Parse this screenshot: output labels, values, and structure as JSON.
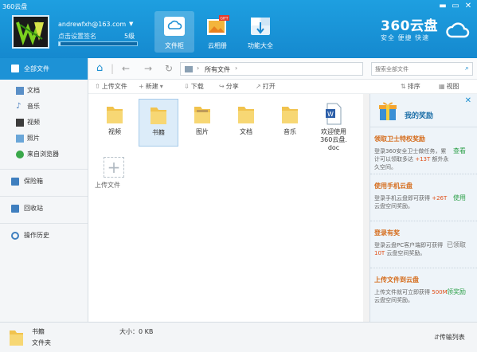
{
  "app": {
    "title": "360云盘"
  },
  "window_controls": [
    "▬",
    "▭",
    "✕"
  ],
  "user": {
    "email": "andrewfxh@163.com",
    "signature_placeholder": "点击设置签名",
    "level": "5级",
    "quota_fraction": 0.02
  },
  "header_tabs": [
    {
      "label": "文件柜",
      "icon": "cloud-cabinet-icon",
      "active": true
    },
    {
      "label": "云相册",
      "icon": "photo-album-icon",
      "active": false,
      "badge": "GIFT"
    },
    {
      "label": "功能大全",
      "icon": "toolbox-icon",
      "active": false
    }
  ],
  "brand": {
    "name": "360云盘",
    "slogan": "安全 便捷 快速"
  },
  "sidebar": {
    "all_files": "全部文件",
    "items": [
      {
        "label": "文档",
        "icon": "document-icon"
      },
      {
        "label": "音乐",
        "icon": "music-icon"
      },
      {
        "label": "视频",
        "icon": "video-icon"
      },
      {
        "label": "照片",
        "icon": "photo-icon"
      },
      {
        "label": "来自浏览器",
        "icon": "browser-icon"
      }
    ],
    "safe_box": "保险箱",
    "recycle_bin": "回收站",
    "history": "操作历史"
  },
  "nav": {
    "breadcrumb": "所有文件",
    "search_placeholder": "搜索全部文件"
  },
  "toolbar": {
    "upload": "上传文件",
    "new": "新建",
    "download": "下载",
    "share": "分享",
    "open": "打开",
    "sort": "排序",
    "view": "视图"
  },
  "files": [
    {
      "name": "视频",
      "type": "folder"
    },
    {
      "name": "书籍",
      "type": "folder",
      "selected": true
    },
    {
      "name": "图片",
      "type": "folder"
    },
    {
      "name": "文档",
      "type": "folder"
    },
    {
      "name": "音乐",
      "type": "folder"
    },
    {
      "name": "欢迎使用\n360云盘.\ndoc",
      "type": "doc"
    }
  ],
  "upload_label": "上传文件",
  "rewards": {
    "title": "我的奖励",
    "items": [
      {
        "title": "领取卫士特权奖励",
        "desc_pre": "登录360安全卫士做任务，累计可以领取多达 ",
        "highlight": "+13T",
        "desc_post": " 额外永久空间。",
        "action": "查看",
        "done": false
      },
      {
        "title": "使用手机云盘",
        "desc_pre": "登录手机云盘即可获得 ",
        "highlight": "+26T",
        "desc_post": " 云盘空间奖励。",
        "action": "使用",
        "done": false
      },
      {
        "title": "登录有奖",
        "desc_pre": "登录云盘PC客户端即可获得 ",
        "highlight": "10T",
        "desc_post": " 云盘空间奖励。",
        "action": "已领取",
        "done": true
      },
      {
        "title": "上传文件到云盘",
        "desc_pre": "上传文件就可立即获得 ",
        "highlight": "500M",
        "desc_post": " 云盘空间奖励。",
        "action": "领奖励",
        "done": false
      }
    ]
  },
  "status": {
    "name": "书籍",
    "type": "文件夹",
    "size": "大小：0 KB",
    "transfer": "传输列表"
  },
  "colors": {
    "header": "#1a96db",
    "accent": "#1d92d6",
    "reward_title": "#d56b1a",
    "reward_action": "#2ea14a"
  }
}
